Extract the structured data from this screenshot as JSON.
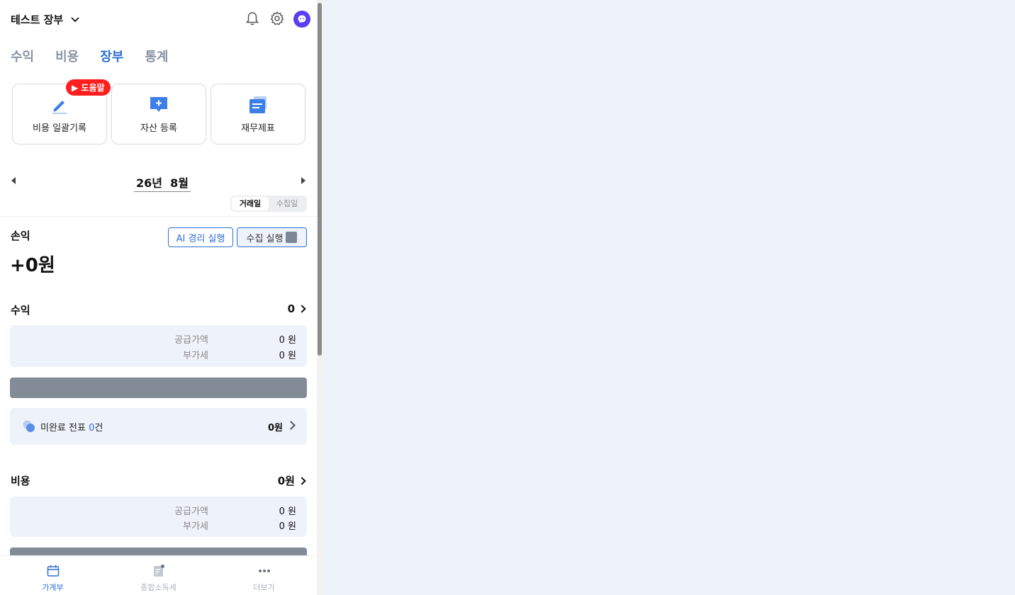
{
  "header": {
    "book_title": "테스트 장부"
  },
  "tabs": [
    {
      "label": "수익",
      "active": false
    },
    {
      "label": "비용",
      "active": false
    },
    {
      "label": "장부",
      "active": true
    },
    {
      "label": "통계",
      "active": false
    }
  ],
  "cards": {
    "help_badge": "▶ 도움말",
    "items": [
      {
        "label": "비용 일괄기록",
        "icon": "pencil-icon"
      },
      {
        "label": "자산 등록",
        "icon": "add-chat-icon"
      },
      {
        "label": "재무제표",
        "icon": "document-stack-icon"
      }
    ]
  },
  "month_nav": {
    "label": "26년  8월"
  },
  "segment": {
    "options": [
      "거래일",
      "수집일"
    ],
    "selected": "거래일"
  },
  "profit_loss": {
    "label": "손익",
    "value": "+0원",
    "ai_button": "AI 경리 실행",
    "collect_button": "수집 실행"
  },
  "income": {
    "title": "수익",
    "total": "0",
    "supply_label": "공급가액",
    "supply_value": "0 원",
    "vat_label": "부가세",
    "vat_value": "0 원"
  },
  "pending": {
    "prefix": "미완료 전표 ",
    "count": "0",
    "suffix": "건",
    "amount": "0원"
  },
  "expense": {
    "title": "비용",
    "total": "0원",
    "supply_label": "공급가액",
    "supply_value": "0 원",
    "vat_label": "부가세",
    "vat_value": "0 원"
  },
  "bottom_nav": [
    {
      "label": "가계부",
      "active": true,
      "icon": "calendar-icon"
    },
    {
      "label": "종합소득세",
      "active": false,
      "icon": "tax-document-icon"
    },
    {
      "label": "더보기",
      "active": false,
      "icon": "more-icon"
    }
  ],
  "colors": {
    "accent": "#2f6fd6",
    "help_badge": "#ff1f1f",
    "avatar": "#5b3df5"
  }
}
